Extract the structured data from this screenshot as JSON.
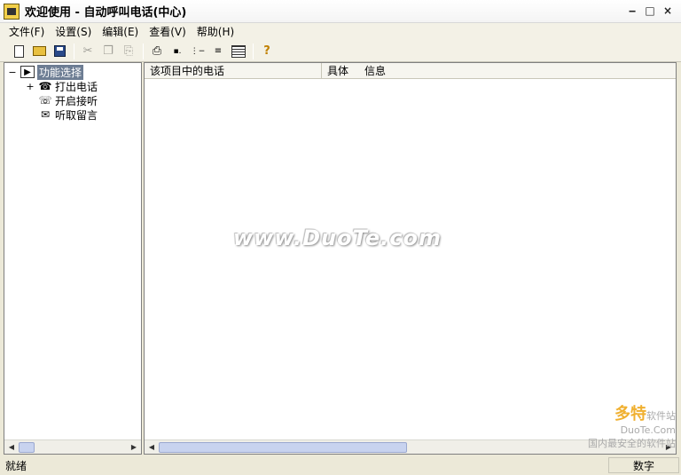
{
  "window": {
    "title": "欢迎使用 - 自动呼叫电话(中心)",
    "buttons": {
      "minimize": "‒",
      "maximize": "□",
      "close": "×"
    }
  },
  "menu": [
    "文件(F)",
    "设置(S)",
    "编辑(E)",
    "查看(V)",
    "帮助(H)"
  ],
  "toolbar": {
    "buttons": [
      {
        "icon": "new-file-icon",
        "disabled": false
      },
      {
        "icon": "open-folder-icon",
        "disabled": false
      },
      {
        "icon": "save-icon",
        "disabled": false
      },
      {
        "icon": "cut-icon",
        "disabled": true
      },
      {
        "icon": "copy-icon",
        "disabled": true
      },
      {
        "icon": "paste-icon",
        "disabled": true
      },
      {
        "icon": "print-icon",
        "disabled": false
      },
      {
        "icon": "large-icons-view-icon",
        "disabled": false
      },
      {
        "icon": "small-icons-view-icon",
        "disabled": false
      },
      {
        "icon": "list-view-icon",
        "disabled": false
      },
      {
        "icon": "details-view-icon",
        "disabled": false
      },
      {
        "icon": "help-icon",
        "disabled": false
      }
    ],
    "glyphs": {
      "cut": "✂",
      "copy": "❐",
      "paste": "⎘",
      "print": "⎙",
      "help": "?"
    }
  },
  "tree": {
    "root": {
      "toggle": "−",
      "label": "功能选择"
    },
    "items": [
      {
        "toggle": "+",
        "label": "打出电话",
        "icon": "phone-call-icon"
      },
      {
        "toggle": "",
        "label": "开启接听",
        "icon": "phone-answer-icon"
      },
      {
        "toggle": "",
        "label": "听取留言",
        "icon": "voicemail-icon"
      }
    ]
  },
  "list": {
    "columns": [
      "该项目中的电话",
      "具体",
      "信息"
    ]
  },
  "watermark": "www.DuoTe.com",
  "corner_logo": {
    "name": "多特",
    "sub": "软件站",
    "site": "DuoTe.Com",
    "tagline": "国内最安全的软件站"
  },
  "status": {
    "main": "就绪",
    "num": "数字"
  },
  "scroll": {
    "left": "◀",
    "right": "▶"
  }
}
